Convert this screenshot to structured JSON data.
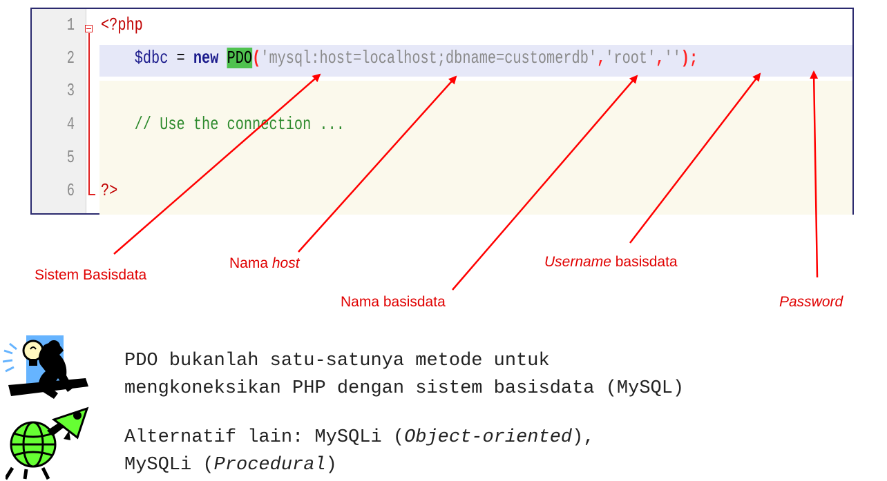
{
  "code": {
    "line_numbers": [
      "1",
      "2",
      "3",
      "4",
      "5",
      "6"
    ],
    "line1": "<?php",
    "line2": {
      "indent": "    ",
      "var": "$dbc",
      "eq": " = ",
      "new": "new",
      "space": " ",
      "pdo": "PDO",
      "open": "(",
      "dsn": "'mysql:host=localhost;dbname=customerdb'",
      "comma1": ",",
      "user": "'root'",
      "comma2": ",",
      "pass": "''",
      "close": ");"
    },
    "line4": "    // Use the connection ...",
    "line6": "?>"
  },
  "annotations": {
    "sistem": "Sistem Basisdata",
    "host_prefix": "Nama ",
    "host_em": "host",
    "nama_db": "Nama basisdata",
    "username_em": "Username",
    "username_suffix": " basisdata",
    "password_em": "Password",
    "arrow_color": "#ff0000"
  },
  "notes": {
    "note1_line1": "PDO bukanlah satu-satunya metode untuk",
    "note1_line2": "mengkoneksikan PHP dengan sistem basisdata (MySQL)",
    "note2_prefix": "Alternatif lain: MySQLi (",
    "note2_em1": "Object-oriented",
    "note2_mid": "),",
    "note2_line2_prefix": "MySQLi (",
    "note2_em2": "Procedural",
    "note2_suffix": ")"
  },
  "clipart": {
    "icon1": "thinking-person-lightbulb-icon",
    "icon2": "globe-rocket-icon"
  }
}
